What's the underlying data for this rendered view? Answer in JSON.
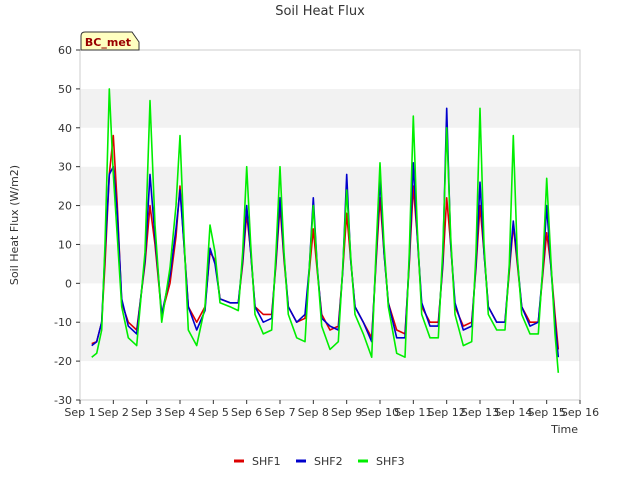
{
  "chart_data": {
    "type": "line",
    "title": "Soil Heat Flux",
    "xlabel": "Time",
    "ylabel": "Soil Heat Flux (W/m2)",
    "station_tag": "BC_met",
    "xlim": [
      1,
      16
    ],
    "ylim": [
      -30,
      60
    ],
    "yticks": [
      -30,
      -20,
      -10,
      0,
      10,
      20,
      30,
      40,
      50,
      60
    ],
    "xticks": [
      {
        "value": 1,
        "label": "Sep 1"
      },
      {
        "value": 2,
        "label": "Sep 2"
      },
      {
        "value": 3,
        "label": "Sep 3"
      },
      {
        "value": 4,
        "label": "Sep 4"
      },
      {
        "value": 5,
        "label": "Sep 5"
      },
      {
        "value": 6,
        "label": "Sep 6"
      },
      {
        "value": 7,
        "label": "Sep 7"
      },
      {
        "value": 8,
        "label": "Sep 8"
      },
      {
        "value": 9,
        "label": "Sep 9"
      },
      {
        "value": 10,
        "label": "Sep 10"
      },
      {
        "value": 11,
        "label": "Sep 11"
      },
      {
        "value": 12,
        "label": "Sep 12"
      },
      {
        "value": 13,
        "label": "Sep 13"
      },
      {
        "value": 14,
        "label": "Sep 14"
      },
      {
        "value": 15,
        "label": "Sep 15"
      },
      {
        "value": 16,
        "label": "Sep 16"
      }
    ],
    "grid": "horizontal bands",
    "legend_position": "bottom",
    "series": [
      {
        "name": "SHF1",
        "color": "#dd0000",
        "x": [
          1.35,
          1.5,
          1.65,
          1.75,
          1.88,
          2.0,
          2.12,
          2.25,
          2.45,
          2.7,
          2.95,
          3.1,
          3.25,
          3.45,
          3.7,
          3.88,
          4.0,
          4.12,
          4.25,
          4.5,
          4.75,
          4.9,
          5.05,
          5.2,
          5.5,
          5.75,
          5.88,
          6.0,
          6.12,
          6.25,
          6.5,
          6.75,
          6.88,
          7.0,
          7.12,
          7.25,
          7.5,
          7.75,
          7.88,
          8.0,
          8.12,
          8.25,
          8.5,
          8.75,
          8.88,
          9.0,
          9.12,
          9.25,
          9.5,
          9.75,
          9.88,
          10.0,
          10.12,
          10.25,
          10.5,
          10.75,
          10.88,
          11.0,
          11.12,
          11.25,
          11.5,
          11.75,
          11.88,
          12.0,
          12.12,
          12.25,
          12.5,
          12.75,
          12.88,
          13.0,
          13.12,
          13.25,
          13.5,
          13.75,
          13.88,
          14.0,
          14.12,
          14.25,
          14.5,
          14.75,
          14.88,
          15.0,
          15.12,
          15.25,
          15.35
        ],
        "y": [
          -15.5,
          -15,
          -10,
          5,
          28,
          38,
          20,
          -5,
          -10,
          -12,
          5,
          20,
          10,
          -8,
          0,
          12,
          25,
          10,
          -6,
          -10,
          -6,
          8,
          6,
          -4,
          -5,
          -5,
          5,
          18,
          8,
          -6,
          -8,
          -8,
          5,
          20,
          6,
          -6,
          -10,
          -9,
          3,
          14,
          3,
          -8,
          -12,
          -11,
          3,
          18,
          6,
          -6,
          -10,
          -14,
          5,
          22,
          8,
          -5,
          -12,
          -13,
          5,
          25,
          12,
          -6,
          -10,
          -10,
          4,
          22,
          10,
          -6,
          -11,
          -10,
          4,
          20,
          8,
          -6,
          -10,
          -10,
          3,
          15,
          5,
          -6,
          -10,
          -10,
          2,
          13,
          5,
          -8,
          -17
        ]
      },
      {
        "name": "SHF2",
        "color": "#0000cc",
        "x": [
          1.35,
          1.5,
          1.65,
          1.75,
          1.88,
          2.0,
          2.12,
          2.25,
          2.45,
          2.7,
          2.95,
          3.1,
          3.25,
          3.45,
          3.7,
          3.88,
          4.0,
          4.12,
          4.25,
          4.5,
          4.75,
          4.9,
          5.05,
          5.2,
          5.5,
          5.75,
          5.88,
          6.0,
          6.12,
          6.25,
          6.5,
          6.75,
          6.88,
          7.0,
          7.12,
          7.25,
          7.5,
          7.75,
          7.88,
          8.0,
          8.12,
          8.25,
          8.5,
          8.75,
          8.88,
          9.0,
          9.12,
          9.25,
          9.5,
          9.75,
          9.88,
          10.0,
          10.12,
          10.25,
          10.5,
          10.75,
          10.88,
          11.0,
          11.12,
          11.25,
          11.5,
          11.75,
          11.88,
          12.0,
          12.12,
          12.25,
          12.5,
          12.75,
          12.88,
          13.0,
          13.12,
          13.25,
          13.5,
          13.75,
          13.88,
          14.0,
          14.12,
          14.25,
          14.5,
          14.75,
          14.88,
          15.0,
          15.12,
          15.25,
          15.35
        ],
        "y": [
          -16,
          -15,
          -10,
          8,
          28,
          30,
          18,
          -4,
          -11,
          -13,
          6,
          28,
          12,
          -8,
          2,
          14,
          24,
          10,
          -6,
          -12,
          -7,
          9,
          5,
          -4,
          -5,
          -5,
          6,
          20,
          8,
          -6,
          -10,
          -9,
          6,
          22,
          7,
          -6,
          -10,
          -8,
          4,
          22,
          4,
          -9,
          -11,
          -12,
          3,
          28,
          6,
          -6,
          -10,
          -15,
          6,
          27,
          8,
          -5,
          -14,
          -14,
          6,
          31,
          12,
          -5,
          -11,
          -11,
          5,
          45,
          10,
          -5,
          -12,
          -11,
          5,
          26,
          8,
          -6,
          -10,
          -10,
          4,
          16,
          6,
          -6,
          -11,
          -10,
          3,
          20,
          5,
          -10,
          -19
        ]
      },
      {
        "name": "SHF3",
        "color": "#00ee00",
        "x": [
          1.35,
          1.5,
          1.65,
          1.75,
          1.88,
          2.0,
          2.12,
          2.25,
          2.45,
          2.7,
          2.95,
          3.1,
          3.25,
          3.45,
          3.7,
          3.88,
          4.0,
          4.12,
          4.25,
          4.5,
          4.75,
          4.9,
          5.05,
          5.2,
          5.5,
          5.75,
          5.88,
          6.0,
          6.12,
          6.25,
          6.5,
          6.75,
          6.88,
          7.0,
          7.12,
          7.25,
          7.5,
          7.75,
          7.88,
          8.0,
          8.12,
          8.25,
          8.5,
          8.75,
          8.88,
          9.0,
          9.12,
          9.25,
          9.5,
          9.75,
          9.88,
          10.0,
          10.12,
          10.25,
          10.5,
          10.75,
          10.88,
          11.0,
          11.12,
          11.25,
          11.5,
          11.75,
          11.88,
          12.0,
          12.12,
          12.25,
          12.5,
          12.75,
          12.88,
          13.0,
          13.12,
          13.25,
          13.5,
          13.75,
          13.88,
          14.0,
          14.12,
          14.25,
          14.5,
          14.75,
          14.88,
          15.0,
          15.12,
          15.25,
          15.35
        ],
        "y": [
          -19,
          -18,
          -12,
          10,
          50,
          28,
          12,
          -6,
          -14,
          -16,
          8,
          47,
          15,
          -10,
          4,
          20,
          38,
          12,
          -12,
          -16,
          -6,
          15,
          8,
          -5,
          -6,
          -7,
          8,
          30,
          10,
          -8,
          -13,
          -12,
          8,
          30,
          8,
          -8,
          -14,
          -15,
          4,
          20,
          4,
          -11,
          -17,
          -15,
          4,
          24,
          7,
          -8,
          -13,
          -19,
          8,
          31,
          10,
          -6,
          -18,
          -19,
          8,
          43,
          14,
          -8,
          -14,
          -14,
          8,
          40,
          12,
          -8,
          -16,
          -15,
          8,
          45,
          10,
          -8,
          -12,
          -12,
          5,
          38,
          7,
          -8,
          -13,
          -13,
          4,
          27,
          7,
          -13,
          -23
        ]
      }
    ]
  }
}
